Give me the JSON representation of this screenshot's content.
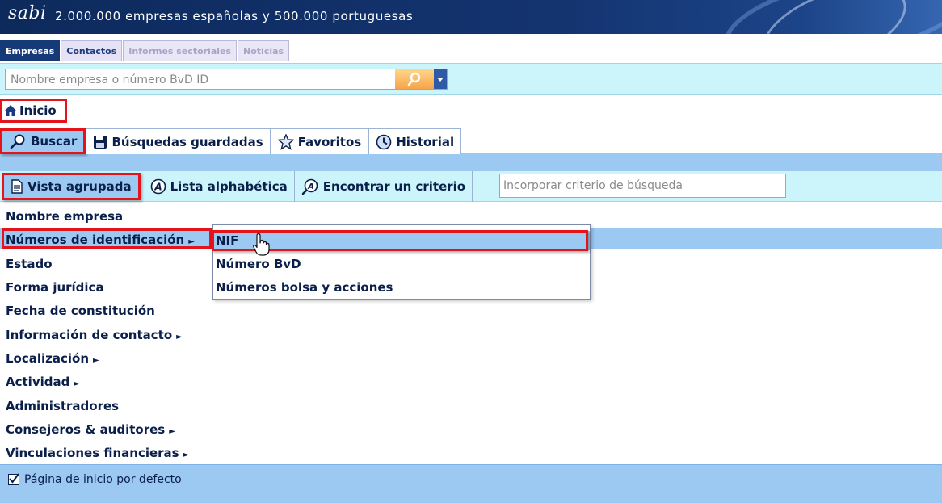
{
  "header": {
    "logo": "sabi",
    "tagline": "2.000.000 empresas españolas y 500.000 portuguesas"
  },
  "top_tabs": [
    {
      "label": "Empresas",
      "state": "active"
    },
    {
      "label": "Contactos",
      "state": "normal"
    },
    {
      "label": "Informes sectoriales",
      "state": "disabled"
    },
    {
      "label": "Noticias",
      "state": "disabled"
    }
  ],
  "search": {
    "placeholder": "Nombre empresa o número BvD ID",
    "value": ""
  },
  "inicio": {
    "label": "Inicio",
    "icon": "home-icon"
  },
  "action_tabs": [
    {
      "label": "Buscar",
      "icon": "search-icon",
      "active": true
    },
    {
      "label": "Búsquedas guardadas",
      "icon": "save-icon",
      "active": false
    },
    {
      "label": "Favoritos",
      "icon": "star-icon",
      "active": false
    },
    {
      "label": "Historial",
      "icon": "history-icon",
      "active": false
    }
  ],
  "view_tabs": [
    {
      "label": "Vista agrupada",
      "icon": "document-icon",
      "active": true
    },
    {
      "label": "Lista alphabética",
      "icon": "letter-a-icon",
      "active": false
    },
    {
      "label": "Encontrar un criterio",
      "icon": "find-criterion-icon",
      "active": false
    }
  ],
  "criterio_search": {
    "placeholder": "Incorporar criterio de búsqueda"
  },
  "criteria": [
    {
      "label": "Nombre empresa",
      "has_submenu": false
    },
    {
      "label": "Números de identificación",
      "has_submenu": true,
      "selected": true
    },
    {
      "label": "Estado",
      "has_submenu": false
    },
    {
      "label": "Forma jurídica",
      "has_submenu": false
    },
    {
      "label": "Fecha de constitución",
      "has_submenu": false
    },
    {
      "label": "Información de contacto",
      "has_submenu": true
    },
    {
      "label": "Localización",
      "has_submenu": true
    },
    {
      "label": "Actividad",
      "has_submenu": true
    },
    {
      "label": "Administradores",
      "has_submenu": false
    },
    {
      "label": "Consejeros & auditores",
      "has_submenu": true
    },
    {
      "label": "Vinculaciones financieras",
      "has_submenu": true
    }
  ],
  "submenu": {
    "items": [
      {
        "label": "NIF",
        "hovered": true
      },
      {
        "label": "Número BvD"
      },
      {
        "label": "Números bolsa y acciones"
      }
    ]
  },
  "footer": {
    "default_home_label": "Página de inicio por defecto",
    "default_home_checked": true
  },
  "colors": {
    "header_bg": "#0d2a5c",
    "accent_band": "#9cc9f2",
    "light_band": "#ccf4fb",
    "highlight_outline": "#e3141c",
    "text": "#0a1f4a"
  }
}
